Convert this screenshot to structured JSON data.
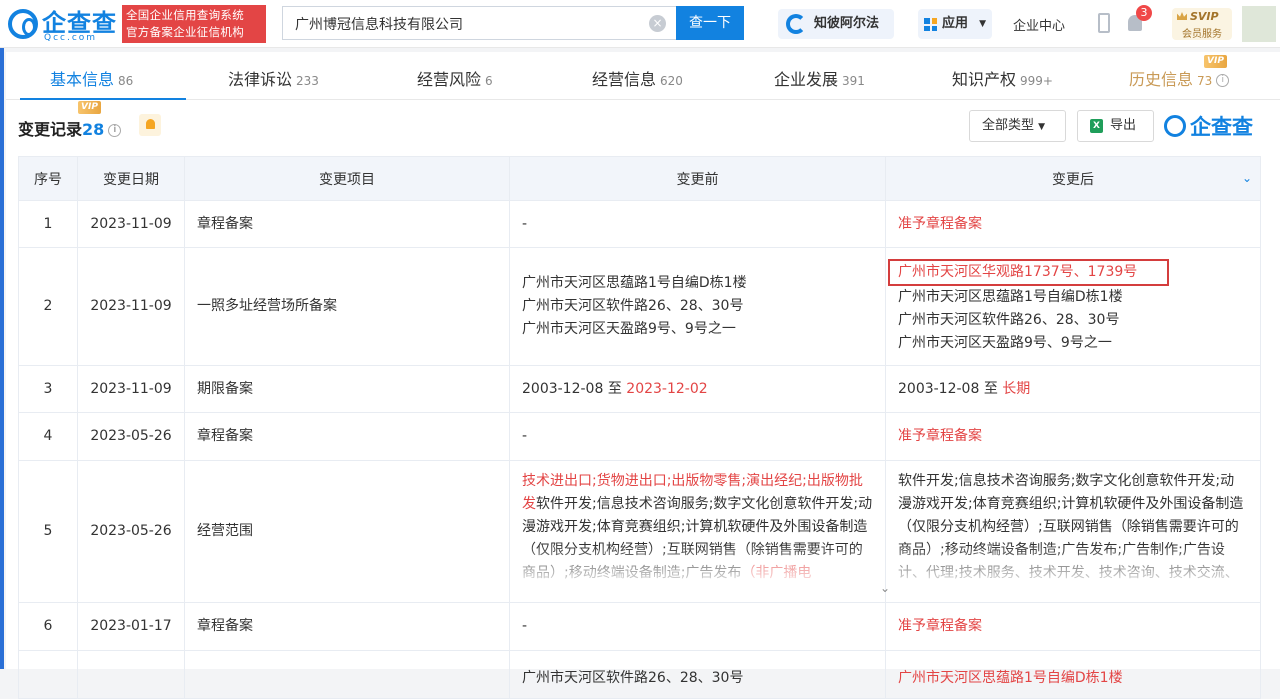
{
  "header": {
    "logo_text": "企查查",
    "logo_sub": "Qcc.com",
    "slogan_line1": "全国企业信用查询系统",
    "slogan_line2": "官方备案企业征信机构",
    "search_value": "广州博冠信息科技有限公司",
    "search_button": "查一下",
    "zhibi_label": "知彼阿尔法",
    "app_label": "应用",
    "enterprise_center": "企业中心",
    "notification_count": "3",
    "svip_label": "SVIP",
    "svip_sub": "会员服务"
  },
  "tabs": [
    {
      "label": "基本信息",
      "count": "86"
    },
    {
      "label": "法律诉讼",
      "count": "233"
    },
    {
      "label": "经营风险",
      "count": "6"
    },
    {
      "label": "经营信息",
      "count": "620"
    },
    {
      "label": "企业发展",
      "count": "391"
    },
    {
      "label": "知识产权",
      "count": "999+"
    },
    {
      "label": "历史信息",
      "count": "73"
    }
  ],
  "vip_tag": "VIP",
  "section": {
    "title": "变更记录",
    "count": "28",
    "filter_label": "全部类型",
    "export_label": "导出",
    "brand": "企查查"
  },
  "table": {
    "columns": [
      "序号",
      "变更日期",
      "变更项目",
      "变更前",
      "变更后"
    ],
    "rows": [
      {
        "no": "1",
        "date": "2023-11-09",
        "item": "章程备案",
        "before": "-",
        "after": "准予章程备案"
      },
      {
        "no": "2",
        "date": "2023-11-09",
        "item": "一照多址经营场所备案",
        "before": [
          "广州市天河区思蕴路1号自编D栋1楼",
          "广州市天河区软件路26、28、30号",
          "广州市天河区天盈路9号、9号之一"
        ],
        "after_highlight": "广州市天河区华观路1737号、1739号",
        "after": [
          "广州市天河区思蕴路1号自编D栋1楼",
          "广州市天河区软件路26、28、30号",
          "广州市天河区天盈路9号、9号之一"
        ]
      },
      {
        "no": "3",
        "date": "2023-11-09",
        "item": "期限备案",
        "before_start": "2003-12-08",
        "before_mid": " 至 ",
        "before_end": "2023-12-02",
        "after_start": "2003-12-08",
        "after_mid": " 至 ",
        "after_end": "长期"
      },
      {
        "no": "4",
        "date": "2023-05-26",
        "item": "章程备案",
        "before": "-",
        "after": "准予章程备案"
      },
      {
        "no": "5",
        "date": "2023-05-26",
        "item": "经营范围",
        "before_red": "技术进出口;货物进出口;出版物零售;演出经纪;出版物批发",
        "before_rest": "软件开发;信息技术咨询服务;数字文化创意软件开发;动漫游戏开发;体育竞赛组织;计算机软硬件及外围设备制造（仅限分支机构经营）;互联网销售（除销售需要许可的商品）;移动终端设备制造;广告发布",
        "before_tail_red": "（非广播电",
        "after": "软件开发;信息技术咨询服务;数字文化创意软件开发;动漫游戏开发;体育竞赛组织;计算机软硬件及外围设备制造（仅限分支机构经营）;互联网销售（除销售需要许可的商品）;移动终端设备制造;广告发布;广告制作;广告设计、代理;技术服务、技术开发、技术咨询、技术交流、"
      },
      {
        "no": "6",
        "date": "2023-01-17",
        "item": "章程备案",
        "before": "-",
        "after": "准予章程备案"
      },
      {
        "no": "",
        "date": "",
        "item": "",
        "before": "广州市天河区软件路26、28、30号",
        "after": "广州市天河区思蕴路1号自编D栋1楼"
      }
    ]
  }
}
